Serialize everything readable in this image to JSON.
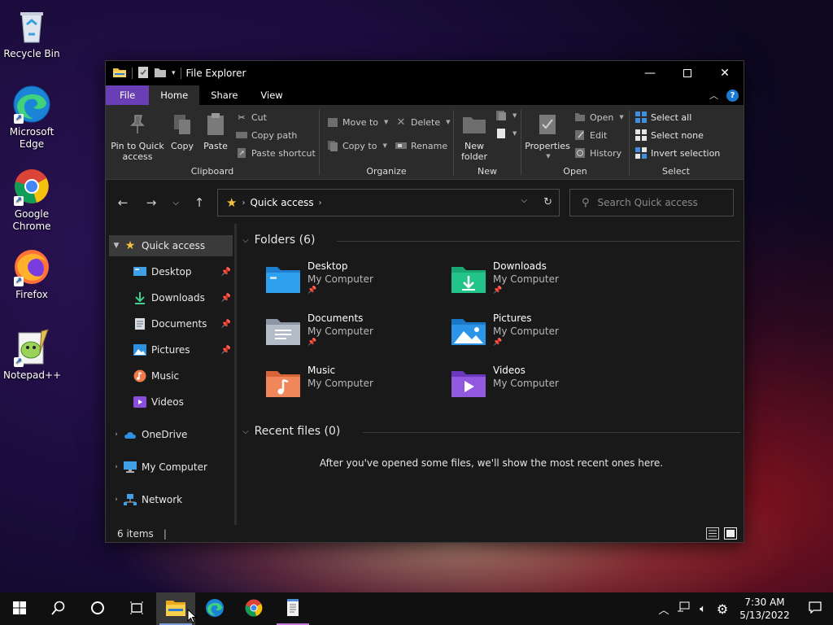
{
  "desktop": {
    "icons": [
      {
        "label": "Recycle Bin"
      },
      {
        "label": "Microsoft Edge"
      },
      {
        "label": "Google Chrome"
      },
      {
        "label": "Firefox"
      },
      {
        "label": "Notepad++"
      }
    ]
  },
  "window": {
    "title": "File Explorer",
    "ribbon_tabs": [
      "File",
      "Home",
      "Share",
      "View"
    ],
    "clipboard": {
      "pin_label": "Pin to Quick access",
      "copy_label": "Copy",
      "paste_label": "Paste",
      "cut_label": "Cut",
      "copy_path_label": "Copy path",
      "paste_shortcut_label": "Paste shortcut",
      "group_label": "Clipboard"
    },
    "organize": {
      "move_to_label": "Move to",
      "copy_to_label": "Copy to",
      "delete_label": "Delete",
      "rename_label": "Rename",
      "group_label": "Organize"
    },
    "new": {
      "new_folder_label": "New folder",
      "group_label": "New"
    },
    "open": {
      "properties_label": "Properties",
      "open_label": "Open",
      "edit_label": "Edit",
      "history_label": "History",
      "group_label": "Open"
    },
    "select": {
      "select_all_label": "Select all",
      "select_none_label": "Select none",
      "invert_label": "Invert selection",
      "group_label": "Select"
    },
    "address": {
      "location": "Quick access"
    },
    "search": {
      "placeholder": "Search Quick access"
    },
    "nav": {
      "quick_access": "Quick access",
      "pinned": [
        "Desktop",
        "Downloads",
        "Documents",
        "Pictures"
      ],
      "others": [
        "Music",
        "Videos"
      ],
      "onedrive": "OneDrive",
      "my_computer": "My Computer",
      "network": "Network"
    },
    "folders_header": "Folders (6)",
    "folders": [
      {
        "name": "Desktop",
        "location": "My Computer"
      },
      {
        "name": "Downloads",
        "location": "My Computer"
      },
      {
        "name": "Documents",
        "location": "My Computer"
      },
      {
        "name": "Pictures",
        "location": "My Computer"
      },
      {
        "name": "Music",
        "location": "My Computer"
      },
      {
        "name": "Videos",
        "location": "My Computer"
      }
    ],
    "recent_header": "Recent files (0)",
    "recent_empty_message": "After you've opened some files, we'll show the most recent ones here.",
    "status": {
      "items": "6 items"
    }
  },
  "taskbar": {
    "time": "7:30 AM",
    "date": "5/13/2022"
  },
  "colors": {
    "file_tab": "#6a3fb5",
    "accent_blue": "#1a7ad4",
    "folder_yellow": "#f4c23b"
  }
}
